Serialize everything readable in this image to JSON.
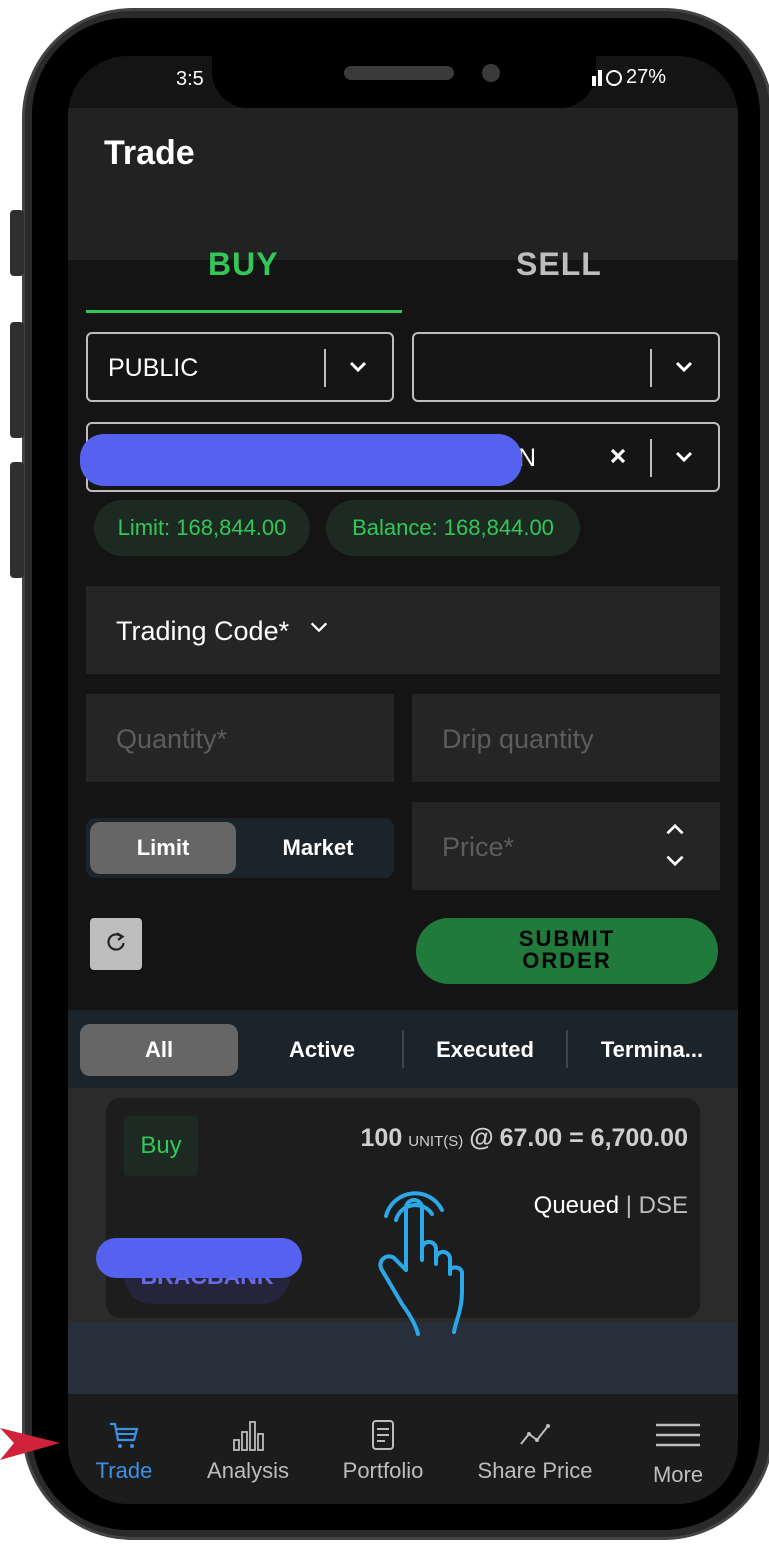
{
  "status_bar": {
    "time": "3:5",
    "battery": "27%"
  },
  "appbar": {
    "title": "Trade"
  },
  "tabs": {
    "buy": "BUY",
    "sell": "SELL"
  },
  "account": {
    "type": "PUBLIC",
    "second_value": "",
    "client_suffix": "N"
  },
  "pills": {
    "limit": "Limit: 168,844.00",
    "balance": "Balance: 168,844.00"
  },
  "form": {
    "trading_code": "Trading Code*",
    "quantity_placeholder": "Quantity*",
    "drip_placeholder": "Drip quantity",
    "price_placeholder": "Price*",
    "limit_label": "Limit",
    "market_label": "Market",
    "submit_line1": "SUBMIT",
    "submit_line2": "ORDER"
  },
  "filters": [
    "All",
    "Active",
    "Executed",
    "Termina..."
  ],
  "order": {
    "side": "Buy",
    "quantity": "100",
    "unit_label": "UNIT(S)",
    "at": "@",
    "price_total": "67.00 = 6,700.00",
    "status": "Queued",
    "separator": "|",
    "exchange": "DSE",
    "symbol": "BRACBANK"
  },
  "nav": {
    "trade": "Trade",
    "analysis": "Analysis",
    "portfolio": "Portfolio",
    "share_price": "Share Price",
    "more": "More"
  },
  "colors": {
    "accent_green": "#33c75a",
    "nav_active": "#3a91e6",
    "redaction": "#5462ef",
    "arrow": "#d0233b",
    "hand": "#2ba8e8"
  },
  "icons": [
    "chevron-down-icon",
    "close-icon",
    "refresh-icon",
    "cart-icon",
    "bar-chart-icon",
    "document-icon",
    "line-chart-icon",
    "menu-icon",
    "tap-hand-icon",
    "arrow-icon"
  ]
}
